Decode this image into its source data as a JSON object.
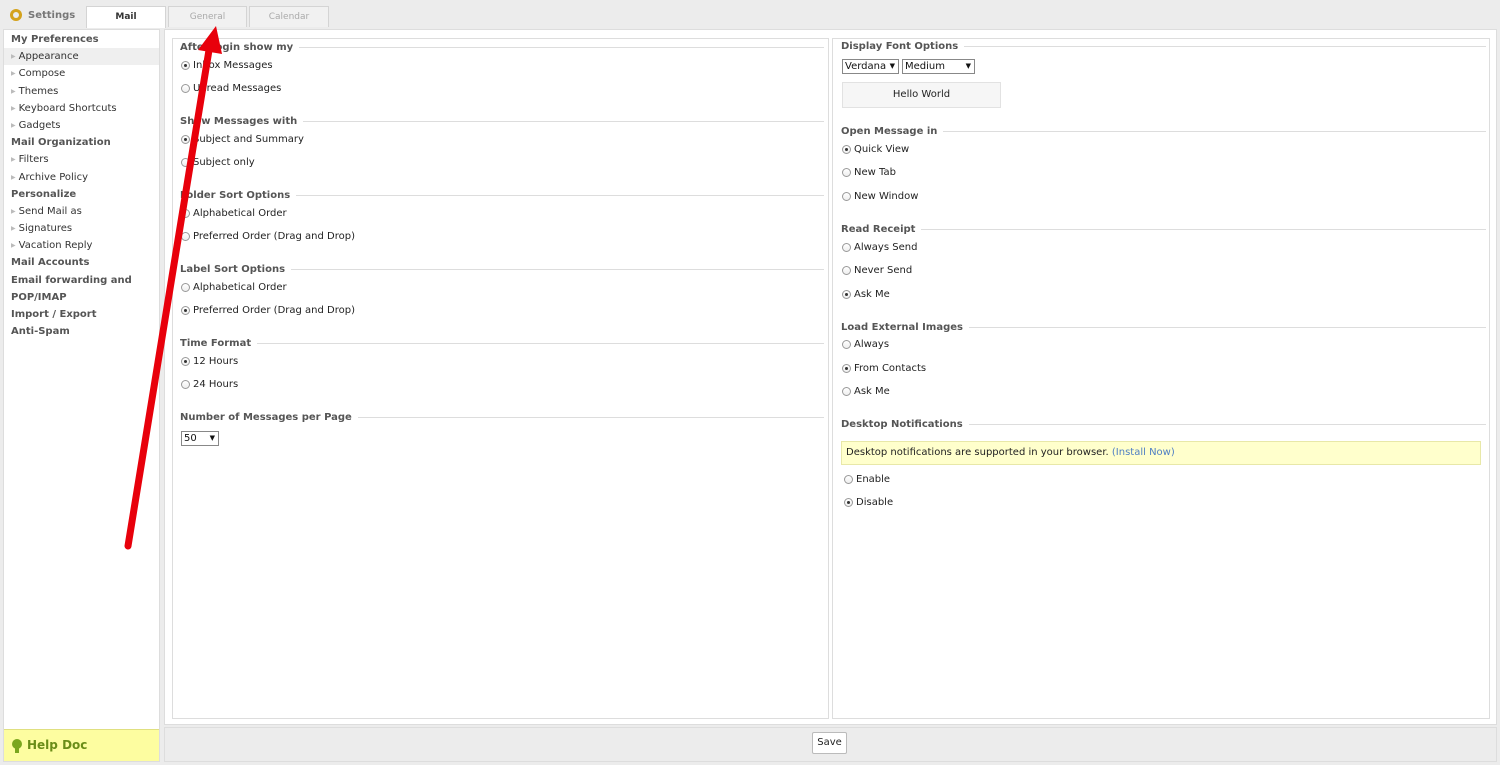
{
  "header": {
    "settings_label": "Settings",
    "tabs": [
      {
        "label": "Mail",
        "active": true
      },
      {
        "label": "General",
        "active": false
      },
      {
        "label": "Calendar",
        "active": false
      }
    ]
  },
  "sidebar": {
    "groups": [
      {
        "heading": "My Preferences",
        "items": [
          "Appearance",
          "Compose",
          "Themes",
          "Keyboard Shortcuts",
          "Gadgets"
        ],
        "selected": "Appearance"
      },
      {
        "heading": "Mail Organization",
        "items": [
          "Filters",
          "Archive Policy"
        ]
      },
      {
        "heading": "Personalize",
        "items": [
          "Send Mail as",
          "Signatures",
          "Vacation Reply"
        ]
      },
      {
        "heading": "Mail Accounts",
        "items": []
      },
      {
        "heading": "Email forwarding and",
        "items": []
      },
      {
        "heading": "POP/IMAP",
        "items": []
      },
      {
        "heading": "Import / Export",
        "items": []
      },
      {
        "heading": "Anti-Spam",
        "items": []
      }
    ],
    "help_label": "Help Doc"
  },
  "left": {
    "after_login": {
      "legend": "After login show my",
      "options": [
        "Inbox Messages",
        "Unread Messages"
      ],
      "selected": 0
    },
    "show_messages": {
      "legend": "Show Messages with",
      "options": [
        "Subject and Summary",
        "Subject only"
      ],
      "selected": 0
    },
    "folder_sort": {
      "legend": "Folder Sort Options",
      "options": [
        "Alphabetical Order",
        "Preferred Order (Drag and Drop)"
      ],
      "selected": null
    },
    "label_sort": {
      "legend": "Label Sort Options",
      "options": [
        "Alphabetical Order",
        "Preferred Order (Drag and Drop)"
      ],
      "selected": 1
    },
    "time_format": {
      "legend": "Time Format",
      "options": [
        "12 Hours",
        "24 Hours"
      ],
      "selected": 0
    },
    "per_page": {
      "legend": "Number of Messages per Page",
      "value": "50"
    }
  },
  "right": {
    "font": {
      "legend": "Display Font Options",
      "family": "Verdana",
      "size": "Medium",
      "preview": "Hello World"
    },
    "open_message": {
      "legend": "Open Message in",
      "options": [
        "Quick View",
        "New Tab",
        "New Window"
      ],
      "selected": 0
    },
    "read_receipt": {
      "legend": "Read Receipt",
      "options": [
        "Always Send",
        "Never Send",
        "Ask Me"
      ],
      "selected": 2
    },
    "external_images": {
      "legend": "Load External Images",
      "options": [
        "Always",
        "From Contacts",
        "Ask Me"
      ],
      "selected": 1
    },
    "notifications": {
      "legend": "Desktop Notifications",
      "notice": "Desktop notifications are supported in your browser.",
      "install_link": "(Install Now)",
      "options": [
        "Enable",
        "Disable"
      ],
      "selected": 1
    }
  },
  "footer": {
    "save_label": "Save"
  },
  "annotation": {
    "arrow_color": "#e8000b"
  }
}
